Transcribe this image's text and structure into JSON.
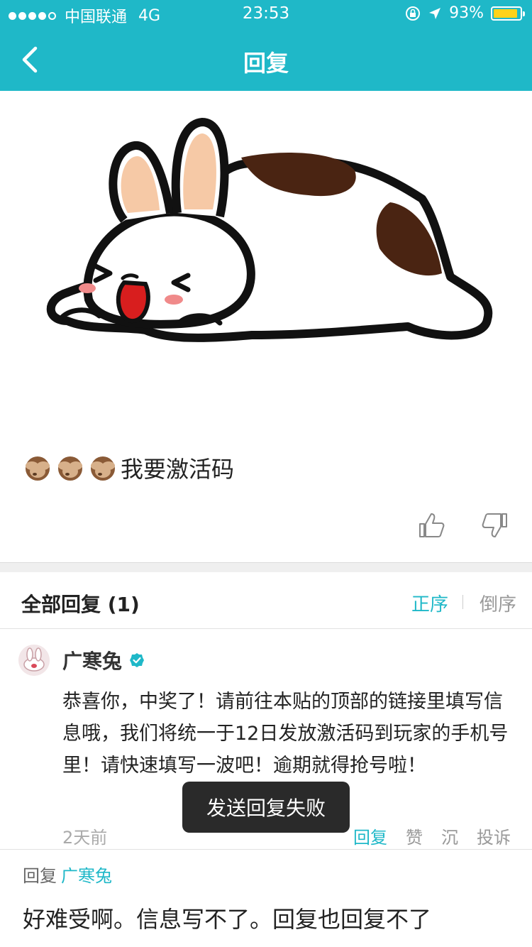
{
  "status": {
    "carrier": "中国联通",
    "network": "4G",
    "time": "23:53",
    "battery": "93%",
    "battery_level": 0.93
  },
  "nav": {
    "title": "回复"
  },
  "post": {
    "text": "我要激活码",
    "emoji_name": "see-no-evil-monkey"
  },
  "replies": {
    "header": "全部回复 (1)",
    "sort_asc": "正序",
    "sort_desc": "倒序"
  },
  "reply": {
    "author": "广寒兔",
    "text": "恭喜你，中奖了！请前往本贴的顶部的链接里填写信息哦，我们将统一于12日发放激活码到玩家的手机号里！请快速填写一波吧！逾期就得抢号啦！",
    "time_ago": "2天前",
    "action_reply": "回复",
    "action_like": "赞",
    "action_sink": "沉",
    "action_report": "投诉"
  },
  "toast": {
    "text": "发送回复失败"
  },
  "subreply": {
    "prefix": "回复",
    "target": "广寒兔",
    "text": "好难受啊。信息写不了。回复也回复不了"
  },
  "colors": {
    "brand": "#1fb8c8",
    "battery": "#ffd21a"
  }
}
